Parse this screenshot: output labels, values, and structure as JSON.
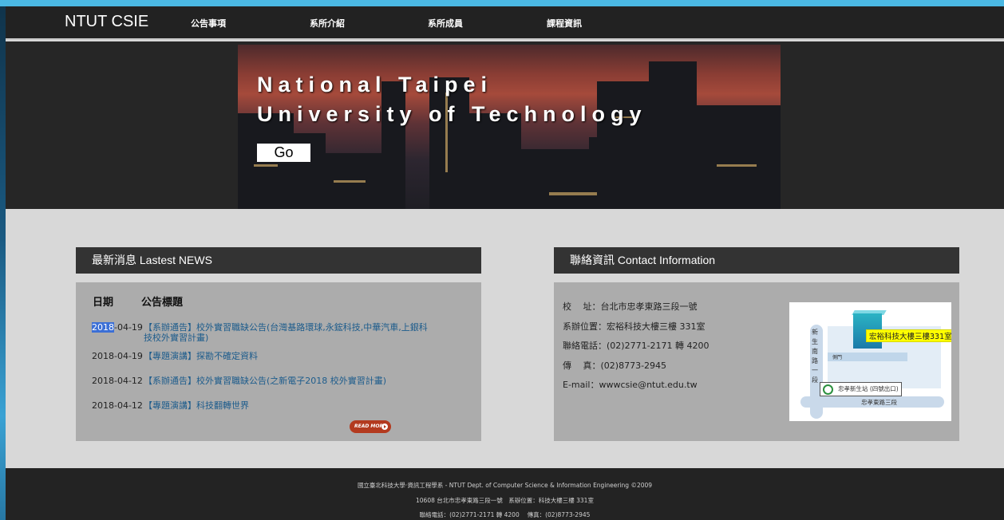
{
  "nav": {
    "brand": "NTUT CSIE",
    "items": [
      "公告事項",
      "系所介紹",
      "系所成員",
      "課程資訊"
    ]
  },
  "hero": {
    "title_line1": "National Taipei",
    "title_line2": "University of Technology",
    "go_label": "Go"
  },
  "news": {
    "heading": "最新消息 Lastest NEWS",
    "col_date": "日期",
    "col_title": "公告標題",
    "items": [
      {
        "date_selected": "2018",
        "date_rest": "-04-19",
        "title": "【系辦通告】校外實習職缺公告(台灣基路環球,永鋐科技,中華汽車,上銀科技校外實習計畫)"
      },
      {
        "date_selected": "",
        "date_rest": "2018-04-19",
        "title": "【專題演講】探勘不確定資料"
      },
      {
        "date_selected": "",
        "date_rest": "2018-04-12",
        "title": "【系辦通告】校外實習職缺公告(之新電子2018 校外實習計畫)"
      },
      {
        "date_selected": "",
        "date_rest": "2018-04-12",
        "title": "【專題演講】科技翻轉世界"
      }
    ],
    "read_more": "READ MORE"
  },
  "contact": {
    "heading": "聯絡資訊 Contact Information",
    "lines": [
      "校　 址：台北市忠孝東路三段一號",
      "系辦位置：宏裕科技大樓三樓 331室",
      "聯絡電話：(02)2771-2171 轉 4200",
      "傳　 真：(02)8773-2945",
      "E-mail：wwwcsie@ntut.edu.tw"
    ],
    "map": {
      "building_label": "宏裕科技大樓三樓331室",
      "road_name": "新生南路一段",
      "gate": "側門",
      "station": "忠孝新生站 (四號出口)",
      "street": "忠孝東路三段"
    }
  },
  "footer": {
    "line1": "國立臺北科技大學·資訊工程學系 - NTUT Dept. of Computer Science & Information Engineering ©2009",
    "line2": "10608 台北市忠孝東路三段一號　系辦位置：科技大樓三樓 331室",
    "line3": "聯絡電話：(02)2771-2171 轉 4200　 傳真：(02)8773-2945"
  }
}
